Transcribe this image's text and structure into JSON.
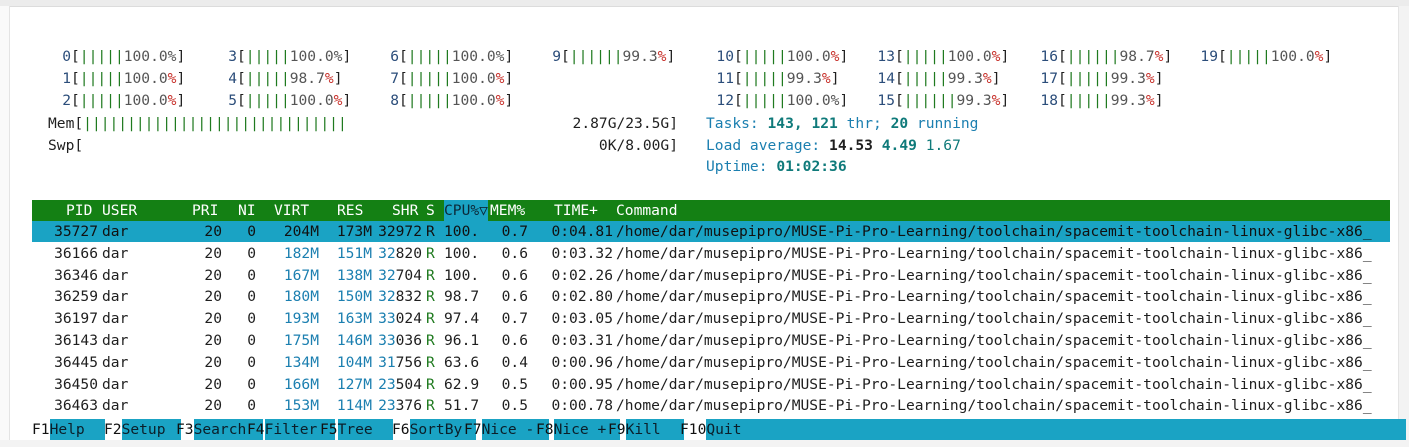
{
  "cpus": [
    {
      "n": "0",
      "bar": "|||||",
      "pct": "100.0%"
    },
    {
      "n": "1",
      "bar": "|||||",
      "pct": "100.0%"
    },
    {
      "n": "2",
      "bar": "|||||",
      "pct": "100.0%"
    },
    {
      "n": "3",
      "bar": "|||||",
      "pct": "100.0%"
    },
    {
      "n": "4",
      "bar": "|||||",
      "pct": "98.7%"
    },
    {
      "n": "5",
      "bar": "|||||",
      "pct": "100.0%"
    },
    {
      "n": "6",
      "bar": "|||||",
      "pct": "100.0%"
    },
    {
      "n": "7",
      "bar": "|||||",
      "pct": "100.0%"
    },
    {
      "n": "8",
      "bar": "|||||",
      "pct": "100.0%"
    },
    {
      "n": "9",
      "bar": "||||||",
      "pct": "99.3%"
    },
    {
      "n": "10",
      "bar": "|||||",
      "pct": "100.0%"
    },
    {
      "n": "11",
      "bar": "|||||",
      "pct": "99.3%"
    },
    {
      "n": "12",
      "bar": "|||||",
      "pct": "100.0%"
    },
    {
      "n": "13",
      "bar": "|||||",
      "pct": "100.0%"
    },
    {
      "n": "14",
      "bar": "|||||",
      "pct": "99.3%"
    },
    {
      "n": "15",
      "bar": "||||||",
      "pct": "99.3%"
    },
    {
      "n": "16",
      "bar": "||||||",
      "pct": "98.7%"
    },
    {
      "n": "17",
      "bar": "|||||",
      "pct": "99.3%"
    },
    {
      "n": "18",
      "bar": "|||||",
      "pct": "99.3%"
    },
    {
      "n": "19",
      "bar": "|||||",
      "pct": "100.0%"
    }
  ],
  "mem": {
    "label": "Mem",
    "bar": "||||||||||||||||||||||||||||||",
    "value": "2.87G/23.5G"
  },
  "swp": {
    "label": "Swp",
    "bar": "",
    "value": "0K/8.00G"
  },
  "tasks": {
    "label": "Tasks:",
    "tasks": "143",
    "thr": "121",
    "thr_label": "thr;",
    "running": "20",
    "running_label": "running"
  },
  "load": {
    "label": "Load average:",
    "v1": "14.53",
    "v5": "4.49",
    "v15": "1.67"
  },
  "uptime": {
    "label": "Uptime:",
    "value": "01:02:36"
  },
  "columns": [
    "PID",
    "USER",
    "PRI",
    "NI",
    "VIRT",
    "RES",
    "SHR",
    "S",
    "CPU%",
    "MEM%",
    "TIME+",
    "Command"
  ],
  "sort_indicator": "▽",
  "processes": [
    {
      "pid": "35727",
      "user": "dar",
      "pri": "20",
      "ni": "0",
      "virt": "204M",
      "res": "173M",
      "shr": "32972",
      "s": "R",
      "cpu": "100.",
      "mem": "0.7",
      "time": "0:04.81",
      "cmd": "/home/dar/musepipro/MUSE-Pi-Pro-Learning/toolchain/spacemit-toolchain-linux-glibc-x86_"
    },
    {
      "pid": "36166",
      "user": "dar",
      "pri": "20",
      "ni": "0",
      "virt": "182M",
      "res": "151M",
      "shr": "32820",
      "s": "R",
      "cpu": "100.",
      "mem": "0.6",
      "time": "0:03.32",
      "cmd": "/home/dar/musepipro/MUSE-Pi-Pro-Learning/toolchain/spacemit-toolchain-linux-glibc-x86_"
    },
    {
      "pid": "36346",
      "user": "dar",
      "pri": "20",
      "ni": "0",
      "virt": "167M",
      "res": "138M",
      "shr": "32704",
      "s": "R",
      "cpu": "100.",
      "mem": "0.6",
      "time": "0:02.26",
      "cmd": "/home/dar/musepipro/MUSE-Pi-Pro-Learning/toolchain/spacemit-toolchain-linux-glibc-x86_"
    },
    {
      "pid": "36259",
      "user": "dar",
      "pri": "20",
      "ni": "0",
      "virt": "180M",
      "res": "150M",
      "shr": "32832",
      "s": "R",
      "cpu": "98.7",
      "mem": "0.6",
      "time": "0:02.80",
      "cmd": "/home/dar/musepipro/MUSE-Pi-Pro-Learning/toolchain/spacemit-toolchain-linux-glibc-x86_"
    },
    {
      "pid": "36197",
      "user": "dar",
      "pri": "20",
      "ni": "0",
      "virt": "193M",
      "res": "163M",
      "shr": "33024",
      "s": "R",
      "cpu": "97.4",
      "mem": "0.7",
      "time": "0:03.05",
      "cmd": "/home/dar/musepipro/MUSE-Pi-Pro-Learning/toolchain/spacemit-toolchain-linux-glibc-x86_"
    },
    {
      "pid": "36143",
      "user": "dar",
      "pri": "20",
      "ni": "0",
      "virt": "175M",
      "res": "146M",
      "shr": "33036",
      "s": "R",
      "cpu": "96.1",
      "mem": "0.6",
      "time": "0:03.31",
      "cmd": "/home/dar/musepipro/MUSE-Pi-Pro-Learning/toolchain/spacemit-toolchain-linux-glibc-x86_"
    },
    {
      "pid": "36445",
      "user": "dar",
      "pri": "20",
      "ni": "0",
      "virt": "134M",
      "res": "104M",
      "shr": "31756",
      "s": "R",
      "cpu": "63.6",
      "mem": "0.4",
      "time": "0:00.96",
      "cmd": "/home/dar/musepipro/MUSE-Pi-Pro-Learning/toolchain/spacemit-toolchain-linux-glibc-x86_"
    },
    {
      "pid": "36450",
      "user": "dar",
      "pri": "20",
      "ni": "0",
      "virt": "166M",
      "res": "127M",
      "shr": "23504",
      "s": "R",
      "cpu": "62.9",
      "mem": "0.5",
      "time": "0:00.95",
      "cmd": "/home/dar/musepipro/MUSE-Pi-Pro-Learning/toolchain/spacemit-toolchain-linux-glibc-x86_"
    },
    {
      "pid": "36463",
      "user": "dar",
      "pri": "20",
      "ni": "0",
      "virt": "153M",
      "res": "114M",
      "shr": "23376",
      "s": "R",
      "cpu": "51.7",
      "mem": "0.5",
      "time": "0:00.78",
      "cmd": "/home/dar/musepipro/MUSE-Pi-Pro-Learning/toolchain/spacemit-toolchain-linux-glibc-x86_"
    }
  ],
  "fkeys": [
    {
      "key": "F1",
      "label": "Help"
    },
    {
      "key": "F2",
      "label": "Setup"
    },
    {
      "key": "F3",
      "label": "Search"
    },
    {
      "key": "F4",
      "label": "Filter"
    },
    {
      "key": "F5",
      "label": "Tree"
    },
    {
      "key": "F6",
      "label": "SortBy"
    },
    {
      "key": "F7",
      "label": "Nice -"
    },
    {
      "key": "F8",
      "label": "Nice +"
    },
    {
      "key": "F9",
      "label": "Kill"
    },
    {
      "key": "F10",
      "label": "Quit"
    }
  ],
  "colors": {
    "header_bg": "#148014",
    "selected_bg": "#1aa3c4",
    "bar_green": "#1f7a1f",
    "cyan": "#1b7fb0",
    "red": "#c8322c"
  }
}
